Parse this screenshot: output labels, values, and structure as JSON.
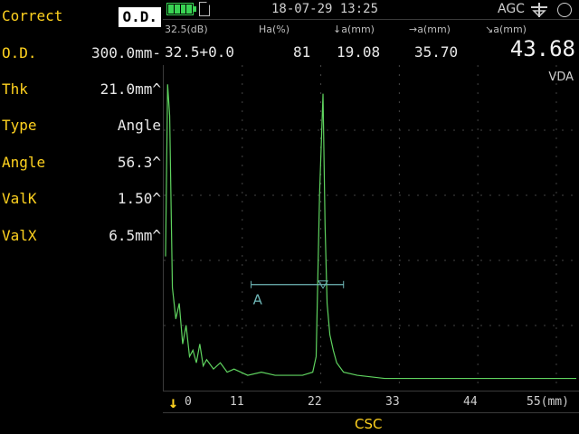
{
  "params": [
    {
      "label": "Correct",
      "value": "O.D.",
      "boxed": true
    },
    {
      "label": "O.D.",
      "value": "300.0mm-"
    },
    {
      "label": "Thk",
      "value": "21.0mm^"
    },
    {
      "label": "Type",
      "value": "Angle"
    },
    {
      "label": "Angle",
      "value": "56.3^"
    },
    {
      "label": "ValK",
      "value": "1.50^"
    },
    {
      "label": "ValX",
      "value": "6.5mm^"
    }
  ],
  "status": {
    "datetime": "18-07-29 13:25",
    "agc": "AGC",
    "battery_level": 4,
    "battery_max": 4
  },
  "readout": {
    "gain_label": "32.5(dB)",
    "gain_value": "32.5+0.0",
    "ha_label": "Ha(%)",
    "ha_value": "81",
    "depth_label": "↓a(mm)",
    "depth_value": "19.08",
    "surface_label": "→a(mm)",
    "surface_value": "35.70",
    "path_label": "↘a(mm)",
    "path_value": "43.68"
  },
  "plot": {
    "mode_tag": "VDA",
    "gate_label": "A",
    "gate_start": 12.5,
    "gate_end": 26.0,
    "gate_level_pct": 31
  },
  "axis": {
    "ticks": [
      "0",
      "11",
      "22",
      "33",
      "44",
      "55(mm)"
    ]
  },
  "mode": {
    "label": "CSC"
  },
  "colors": {
    "label": "#ffd21f",
    "trace": "#5fd35f",
    "gate": "#6fb7b7",
    "grid": "#444444"
  },
  "chart_data": {
    "type": "line",
    "xlabel": "(mm)",
    "ylabel": "",
    "xlim": [
      0,
      60
    ],
    "ylim": [
      0,
      100
    ],
    "grid": true,
    "series": [
      {
        "x": [
          0,
          0.3,
          0.6,
          1.0,
          1.5,
          2.0,
          2.5,
          3.0,
          3.5,
          4.0,
          4.5,
          5.0,
          5.5,
          6.0,
          7.0,
          8.0,
          9.0,
          10.0,
          12.0,
          14.0,
          16.0,
          18.0,
          20.0,
          21.5,
          22.0,
          22.5,
          23.0,
          23.3,
          23.6,
          24.0,
          24.5,
          25.0,
          26.0,
          28.0,
          32.0,
          40.0,
          50.0,
          60.0
        ],
        "y": [
          40,
          95,
          85,
          30,
          20,
          25,
          12,
          18,
          8,
          10,
          6,
          12,
          5,
          7,
          4,
          6,
          3,
          4,
          2,
          3,
          2,
          2,
          2,
          3,
          8,
          60,
          92,
          50,
          25,
          15,
          10,
          6,
          3,
          2,
          1,
          1,
          1,
          1
        ]
      }
    ]
  }
}
